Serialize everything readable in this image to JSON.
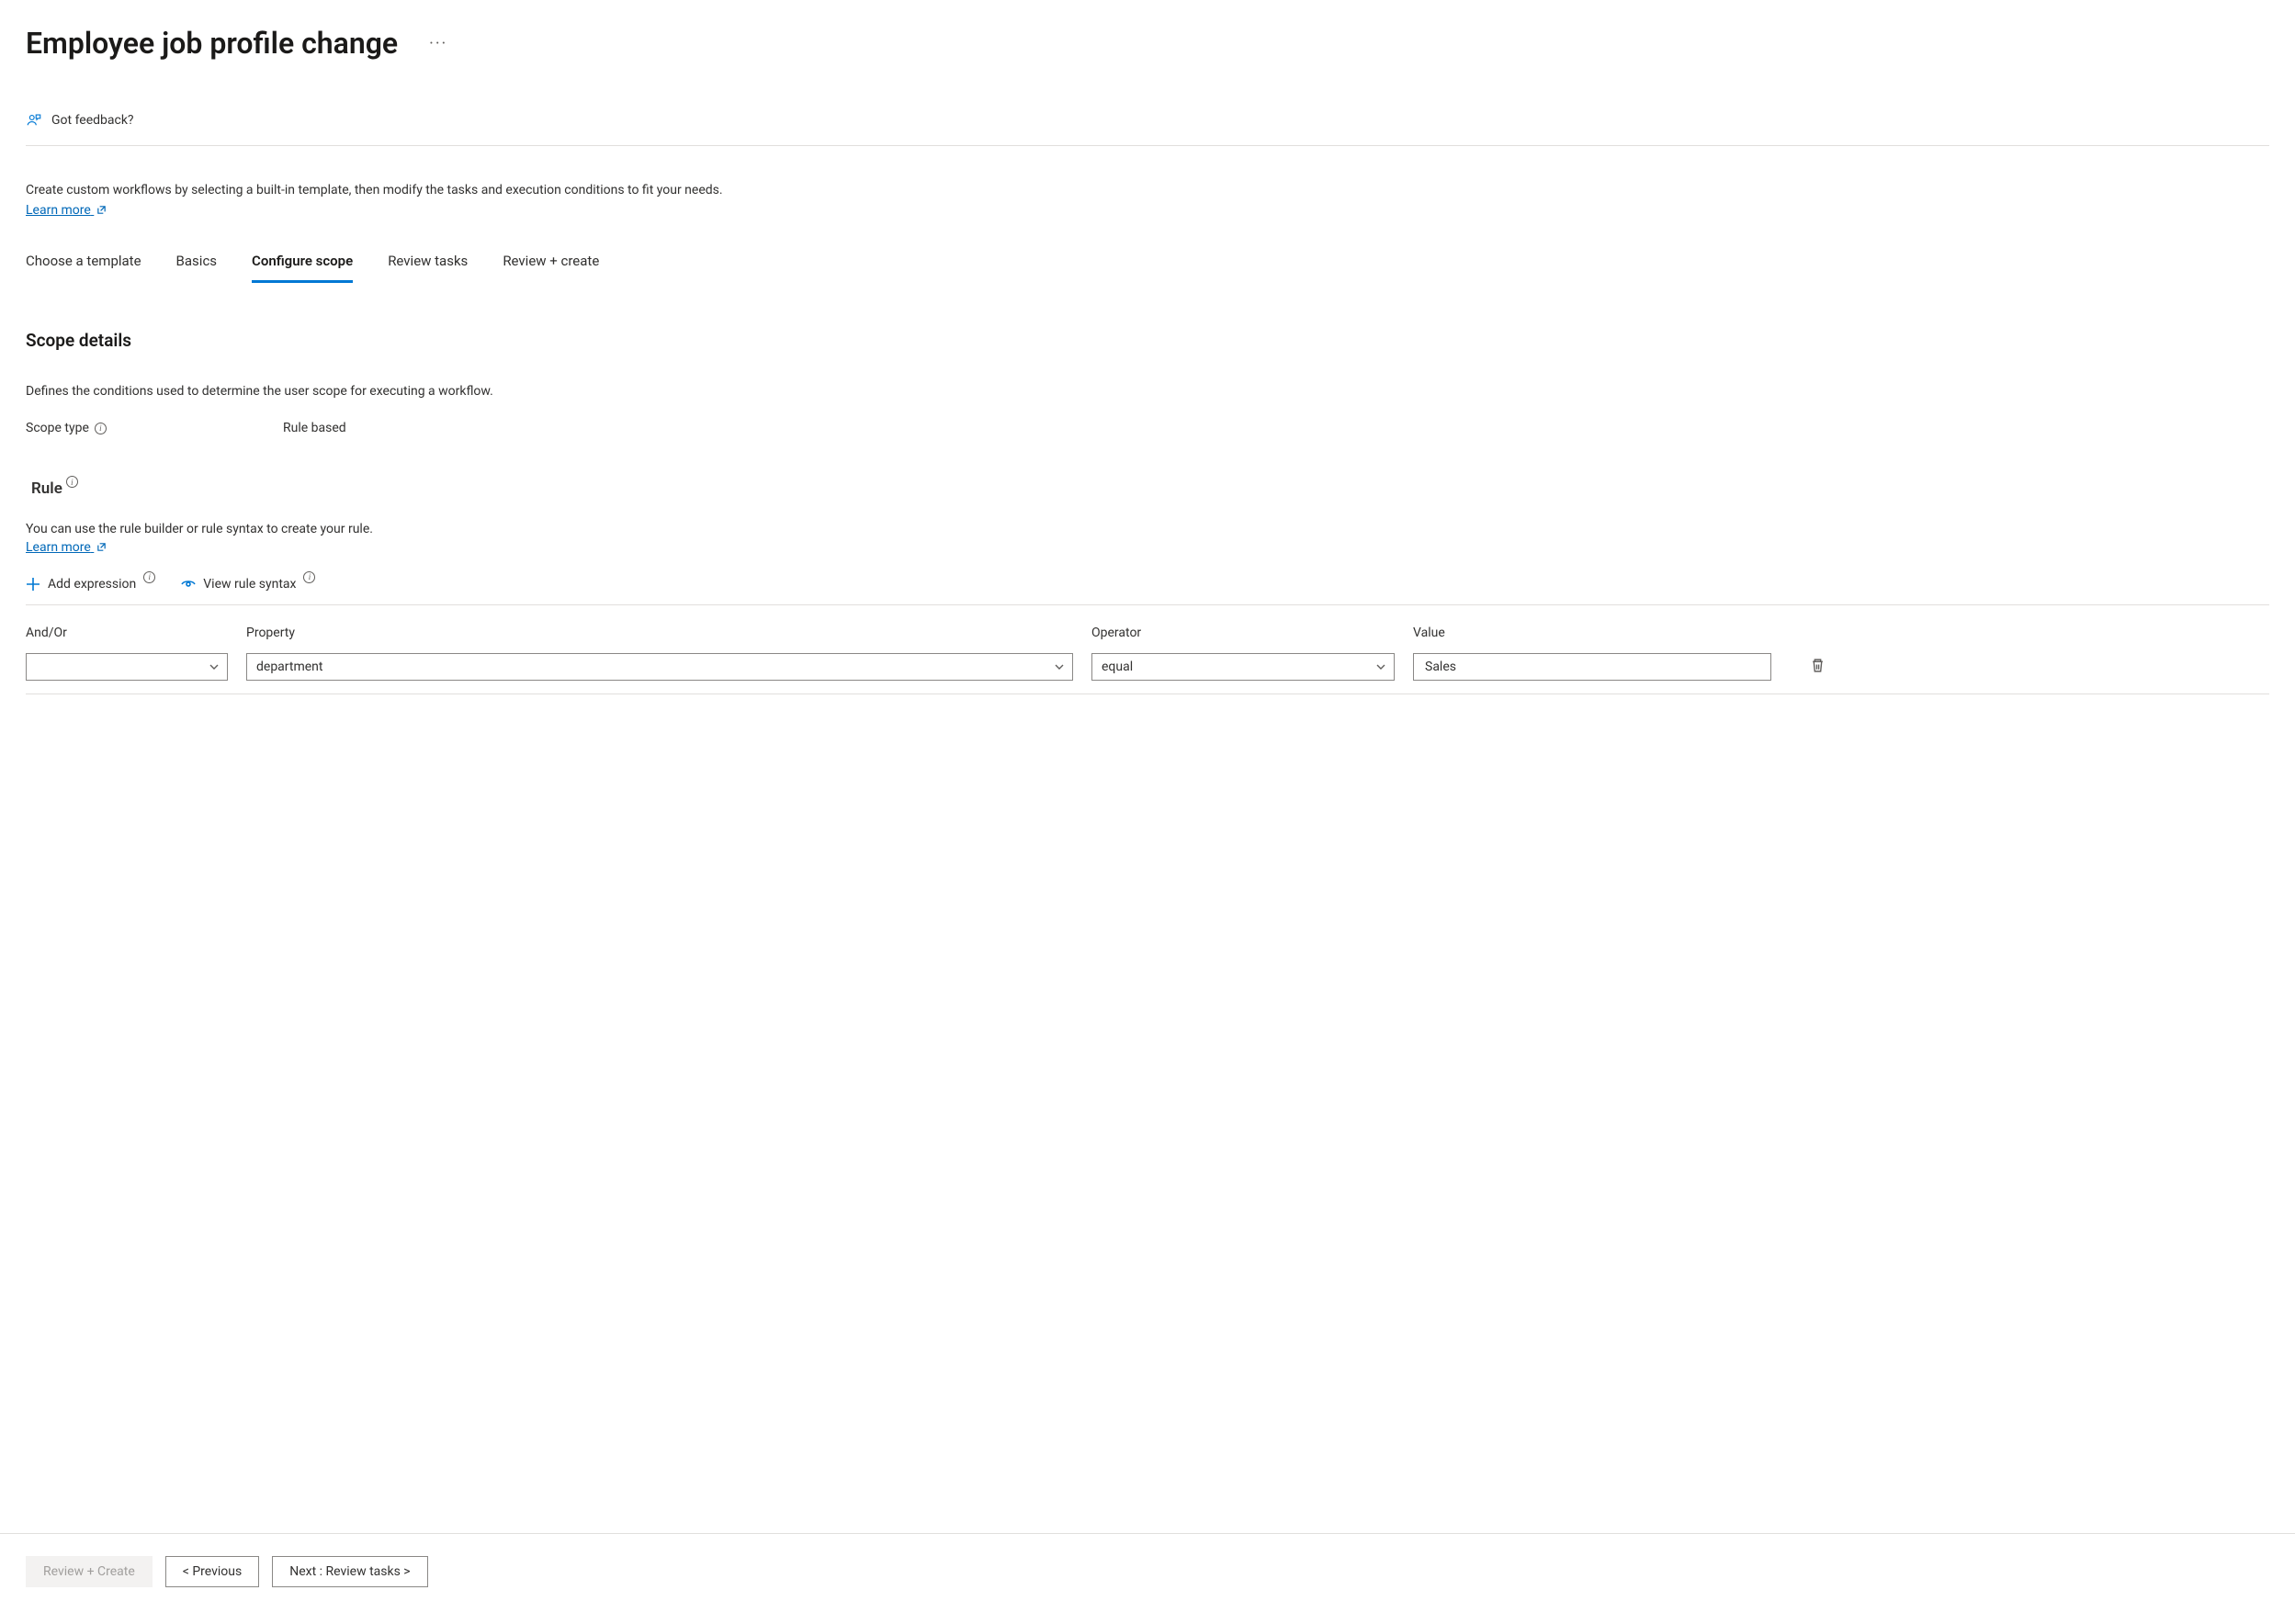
{
  "header": {
    "title": "Employee job profile change",
    "more_label": "···"
  },
  "feedback": {
    "label": "Got feedback?"
  },
  "intro": {
    "text": "Create custom workflows by selecting a built-in template, then modify the tasks and execution conditions to fit your needs.",
    "learn_more": "Learn more"
  },
  "tabs": [
    {
      "label": "Choose a template",
      "active": false
    },
    {
      "label": "Basics",
      "active": false
    },
    {
      "label": "Configure scope",
      "active": true
    },
    {
      "label": "Review tasks",
      "active": false
    },
    {
      "label": "Review + create",
      "active": false
    }
  ],
  "scope": {
    "title": "Scope details",
    "description": "Defines the conditions used to determine the user scope for executing a workflow.",
    "type_label": "Scope type",
    "type_value": "Rule based"
  },
  "rule": {
    "title": "Rule",
    "description": "You can use the rule builder or rule syntax to create your rule.",
    "learn_more": "Learn more",
    "toolbar": {
      "add_expression": "Add expression",
      "view_syntax": "View rule syntax"
    },
    "columns": {
      "andor": "And/Or",
      "property": "Property",
      "operator": "Operator",
      "value": "Value"
    },
    "rows": [
      {
        "andor": "",
        "property": "department",
        "operator": "equal",
        "value": "Sales"
      }
    ]
  },
  "footer": {
    "review_create": "Review + Create",
    "previous": "< Previous",
    "next": "Next : Review tasks >"
  }
}
